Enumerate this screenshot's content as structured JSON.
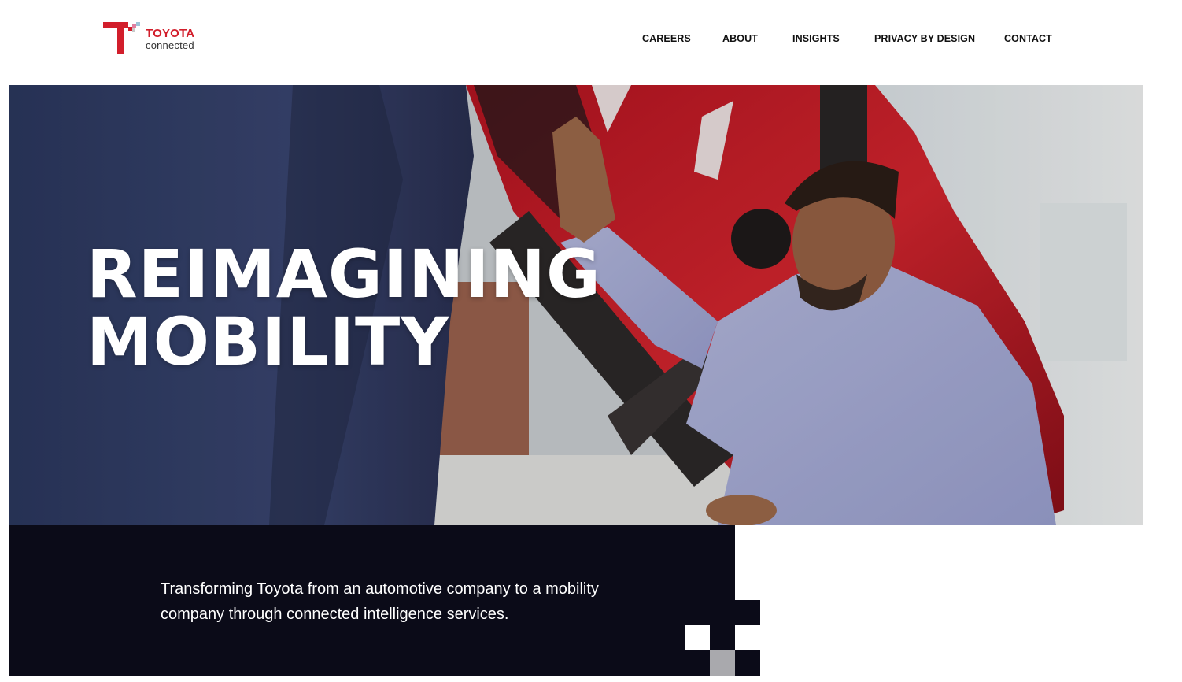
{
  "header": {
    "logo": {
      "brand": "TOYOTA",
      "sub": "connected",
      "brand_color": "#d21e2b"
    },
    "nav": [
      {
        "label": "CAREERS"
      },
      {
        "label": "ABOUT"
      },
      {
        "label": "INSIGHTS"
      },
      {
        "label": "PRIVACY BY DESIGN"
      },
      {
        "label": "CONTACT"
      }
    ]
  },
  "hero": {
    "title_line1": "REIMAGINING",
    "title_line2": "MOBILITY",
    "image_description_icon": "hero-photo"
  },
  "panel": {
    "tagline": "Transforming Toyota from an automotive company to a mobility company through connected intelligence services.",
    "background_color": "#0b0b18"
  }
}
